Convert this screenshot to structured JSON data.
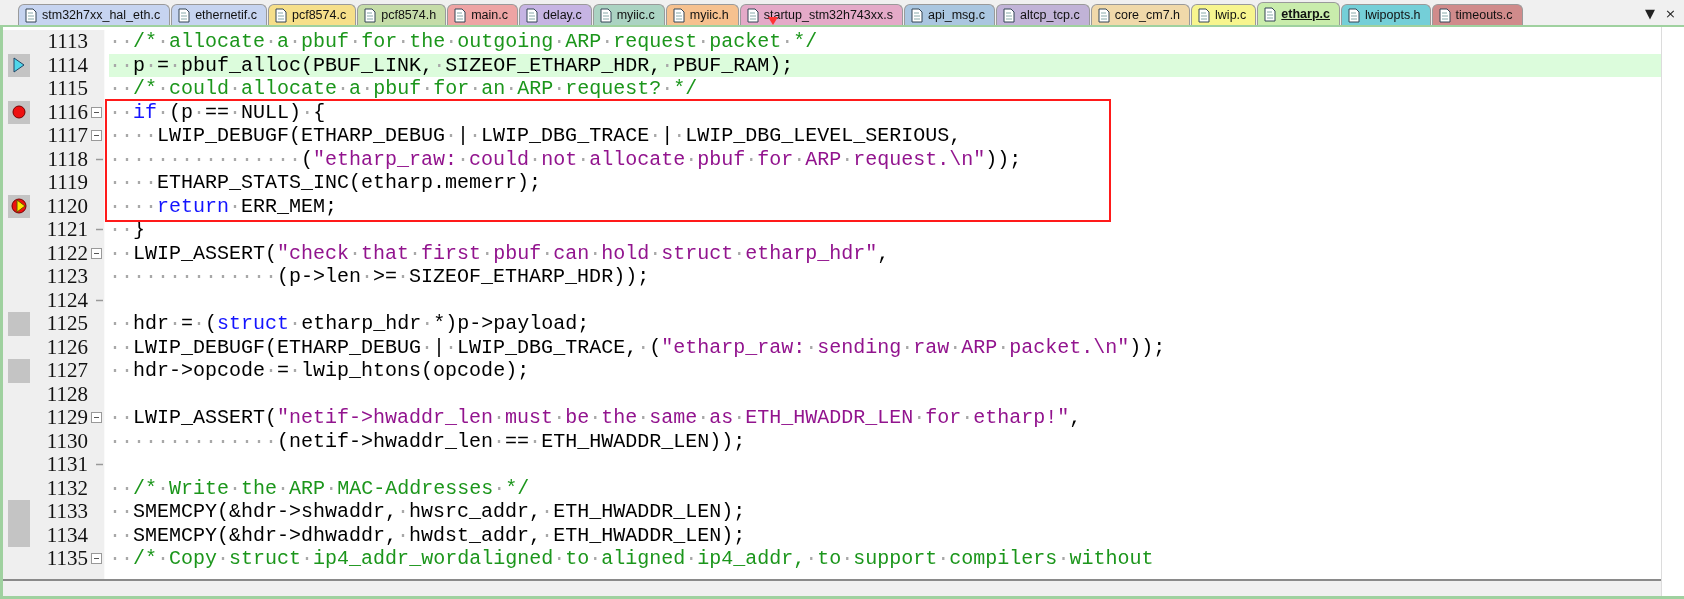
{
  "tabs": [
    {
      "label": "stm32h7xx_hal_eth.c",
      "color": "#c6d4f0",
      "selected": false
    },
    {
      "label": "ethernetif.c",
      "color": "#c6d4f0",
      "selected": false
    },
    {
      "label": "pcf8574.c",
      "color": "#f6df8a",
      "selected": false
    },
    {
      "label": "pcf8574.h",
      "color": "#c5dca8",
      "selected": false
    },
    {
      "label": "main.c",
      "color": "#eea4a4",
      "selected": false
    },
    {
      "label": "delay.c",
      "color": "#c6b4e3",
      "selected": false
    },
    {
      "label": "myiic.c",
      "color": "#abd3c2",
      "selected": false
    },
    {
      "label": "myiic.h",
      "color": "#f6c18f",
      "selected": false
    },
    {
      "label": "startup_stm32h743xx.s",
      "color": "#e4aac8",
      "selected": false
    },
    {
      "label": "api_msg.c",
      "color": "#aac6e0",
      "selected": false
    },
    {
      "label": "altcp_tcp.c",
      "color": "#c1b3d7",
      "selected": false
    },
    {
      "label": "core_cm7.h",
      "color": "#f0d9aa",
      "selected": false
    },
    {
      "label": "lwip.c",
      "color": "#f7f58e",
      "selected": false
    },
    {
      "label": "etharp.c",
      "color": "#c9ecac",
      "selected": true
    },
    {
      "label": "lwipopts.h",
      "color": "#74cfd8",
      "selected": false
    },
    {
      "label": "timeouts.c",
      "color": "#d08b8b",
      "selected": false
    }
  ],
  "tab_menu_glyph": "▼",
  "tab_close_glyph": "×",
  "lines": [
    {
      "number": "1113",
      "current": false,
      "breakpoint": false,
      "executable": false,
      "fold_open": false,
      "fold_end": false,
      "highlighted": false,
      "boxed": false,
      "segments": [
        {
          "kind": "comment",
          "text": "··/*·allocate·a·pbuf·for·the·outgoing·ARP·request·packet·*/"
        }
      ]
    },
    {
      "number": "1114",
      "current": true,
      "breakpoint": false,
      "executable": true,
      "fold_open": false,
      "fold_end": false,
      "highlighted": true,
      "boxed": false,
      "segments": [
        {
          "kind": "plain",
          "text": "··p·=·pbuf_alloc(PBUF_LINK,·SIZEOF_ETHARP_HDR,·PBUF_RAM);"
        }
      ]
    },
    {
      "number": "1115",
      "current": false,
      "breakpoint": false,
      "executable": false,
      "fold_open": false,
      "fold_end": false,
      "highlighted": false,
      "boxed": false,
      "segments": [
        {
          "kind": "comment",
          "text": "··/*·could·allocate·a·pbuf·for·an·ARP·request?·*/"
        }
      ]
    },
    {
      "number": "1116",
      "current": false,
      "breakpoint": true,
      "executable": true,
      "fold_open": true,
      "fold_end": false,
      "highlighted": false,
      "boxed": true,
      "segments": [
        {
          "kind": "plain",
          "text": "··"
        },
        {
          "kind": "keyword",
          "text": "if"
        },
        {
          "kind": "plain",
          "text": "·(p·==·NULL)·{"
        }
      ]
    },
    {
      "number": "1117",
      "current": false,
      "breakpoint": false,
      "executable": false,
      "fold_open": true,
      "fold_end": false,
      "highlighted": false,
      "boxed": true,
      "segments": [
        {
          "kind": "plain",
          "text": "····LWIP_DEBUGF(ETHARP_DEBUG·|·LWIP_DBG_TRACE·|·LWIP_DBG_LEVEL_SERIOUS,"
        }
      ]
    },
    {
      "number": "1118",
      "current": false,
      "breakpoint": false,
      "executable": false,
      "fold_open": false,
      "fold_end": true,
      "highlighted": false,
      "boxed": true,
      "segments": [
        {
          "kind": "plain",
          "text": "················("
        },
        {
          "kind": "string",
          "text": "\"etharp_raw:·could·not·allocate·pbuf·for·ARP·request.\\n\""
        },
        {
          "kind": "plain",
          "text": "));"
        }
      ]
    },
    {
      "number": "1119",
      "current": false,
      "breakpoint": false,
      "executable": false,
      "fold_open": false,
      "fold_end": false,
      "highlighted": false,
      "boxed": true,
      "segments": [
        {
          "kind": "plain",
          "text": "····ETHARP_STATS_INC(etharp.memerr);"
        }
      ]
    },
    {
      "number": "1120",
      "current": true,
      "breakpoint": true,
      "executable": true,
      "fold_open": false,
      "fold_end": false,
      "highlighted": false,
      "boxed": true,
      "segments": [
        {
          "kind": "plain",
          "text": "····"
        },
        {
          "kind": "keyword",
          "text": "return"
        },
        {
          "kind": "plain",
          "text": "·ERR_MEM;"
        }
      ]
    },
    {
      "number": "1121",
      "current": false,
      "breakpoint": false,
      "executable": false,
      "fold_open": false,
      "fold_end": true,
      "highlighted": false,
      "boxed": false,
      "segments": [
        {
          "kind": "plain",
          "text": "··}"
        }
      ]
    },
    {
      "number": "1122",
      "current": false,
      "breakpoint": false,
      "executable": false,
      "fold_open": true,
      "fold_end": false,
      "highlighted": false,
      "boxed": false,
      "segments": [
        {
          "kind": "plain",
          "text": "··LWIP_ASSERT("
        },
        {
          "kind": "string",
          "text": "\"check·that·first·pbuf·can·hold·struct·etharp_hdr\""
        },
        {
          "kind": "plain",
          "text": ","
        }
      ]
    },
    {
      "number": "1123",
      "current": false,
      "breakpoint": false,
      "executable": false,
      "fold_open": false,
      "fold_end": false,
      "highlighted": false,
      "boxed": false,
      "segments": [
        {
          "kind": "plain",
          "text": "··············(p->len·>=·SIZEOF_ETHARP_HDR));"
        }
      ]
    },
    {
      "number": "1124",
      "current": false,
      "breakpoint": false,
      "executable": false,
      "fold_open": false,
      "fold_end": true,
      "highlighted": false,
      "boxed": false
    },
    {
      "number": "1125",
      "current": false,
      "breakpoint": false,
      "executable": true,
      "fold_open": false,
      "fold_end": false,
      "highlighted": false,
      "boxed": false,
      "segments": [
        {
          "kind": "plain",
          "text": "··hdr·=·("
        },
        {
          "kind": "keyword",
          "text": "struct"
        },
        {
          "kind": "plain",
          "text": "·etharp_hdr·*)p->payload;"
        }
      ]
    },
    {
      "number": "1126",
      "current": false,
      "breakpoint": false,
      "executable": false,
      "fold_open": false,
      "fold_end": false,
      "highlighted": false,
      "boxed": false,
      "segments": [
        {
          "kind": "plain",
          "text": "··LWIP_DEBUGF(ETHARP_DEBUG·|·LWIP_DBG_TRACE,·("
        },
        {
          "kind": "string",
          "text": "\"etharp_raw:·sending·raw·ARP·packet.\\n\""
        },
        {
          "kind": "plain",
          "text": "));"
        }
      ]
    },
    {
      "number": "1127",
      "current": false,
      "breakpoint": false,
      "executable": true,
      "fold_open": false,
      "fold_end": false,
      "highlighted": false,
      "boxed": false,
      "segments": [
        {
          "kind": "plain",
          "text": "··hdr->opcode·=·lwip_htons(opcode);"
        }
      ]
    },
    {
      "number": "1128",
      "current": false,
      "breakpoint": false,
      "executable": false,
      "fold_open": false,
      "fold_end": false,
      "highlighted": false,
      "boxed": false
    },
    {
      "number": "1129",
      "current": false,
      "breakpoint": false,
      "executable": false,
      "fold_open": true,
      "fold_end": false,
      "highlighted": false,
      "boxed": false,
      "segments": [
        {
          "kind": "plain",
          "text": "··LWIP_ASSERT("
        },
        {
          "kind": "string",
          "text": "\"netif->hwaddr_len·must·be·the·same·as·ETH_HWADDR_LEN·for·etharp!\""
        },
        {
          "kind": "plain",
          "text": ","
        }
      ]
    },
    {
      "number": "1130",
      "current": false,
      "breakpoint": false,
      "executable": false,
      "fold_open": false,
      "fold_end": false,
      "highlighted": false,
      "boxed": false,
      "segments": [
        {
          "kind": "plain",
          "text": "··············(netif->hwaddr_len·==·ETH_HWADDR_LEN));"
        }
      ]
    },
    {
      "number": "1131",
      "current": false,
      "breakpoint": false,
      "executable": false,
      "fold_open": false,
      "fold_end": true,
      "highlighted": false,
      "boxed": false
    },
    {
      "number": "1132",
      "current": false,
      "breakpoint": false,
      "executable": false,
      "fold_open": false,
      "fold_end": false,
      "highlighted": false,
      "boxed": false,
      "segments": [
        {
          "kind": "comment",
          "text": "··/*·Write·the·ARP·MAC-Addresses·*/"
        }
      ]
    },
    {
      "number": "1133",
      "current": false,
      "breakpoint": false,
      "executable": true,
      "fold_open": false,
      "fold_end": false,
      "highlighted": false,
      "boxed": false,
      "segments": [
        {
          "kind": "plain",
          "text": "··SMEMCPY(&hdr->shwaddr,·hwsrc_addr,·ETH_HWADDR_LEN);"
        }
      ]
    },
    {
      "number": "1134",
      "current": false,
      "breakpoint": false,
      "executable": true,
      "fold_open": false,
      "fold_end": false,
      "highlighted": false,
      "boxed": false,
      "segments": [
        {
          "kind": "plain",
          "text": "··SMEMCPY(&hdr->dhwaddr,·hwdst_addr,·ETH_HWADDR_LEN);"
        }
      ]
    },
    {
      "number": "1135",
      "current": false,
      "breakpoint": false,
      "executable": false,
      "fold_open": true,
      "fold_end": false,
      "highlighted": false,
      "boxed": false,
      "segments": [
        {
          "kind": "comment",
          "text": "··/*·Copy·struct·ip4_addr_wordaligned·to·aligned·ip4_addr,·to·support·compilers·without"
        }
      ]
    }
  ]
}
